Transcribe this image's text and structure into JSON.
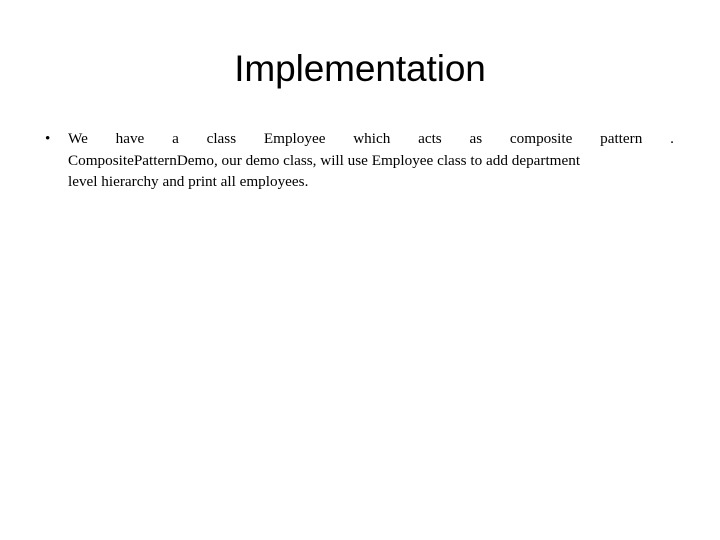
{
  "slide": {
    "title": "Implementation",
    "bullets": [
      {
        "marker": "•",
        "line1_words": [
          "We",
          "have",
          "a",
          "class",
          "Employee",
          "which",
          "acts",
          "as",
          "composite",
          "pattern",
          "."
        ],
        "line2": "CompositePatternDemo, our demo class, will use Employee class to add department",
        "line3": "level hierarchy and print all employees.",
        "full_text": "We have a class Employee which acts as composite pattern . CompositePatternDemo, our demo class, will use Employee class to add department level hierarchy and print all employees."
      }
    ]
  },
  "colors": {
    "background": "#ffffff",
    "text": "#000000"
  }
}
